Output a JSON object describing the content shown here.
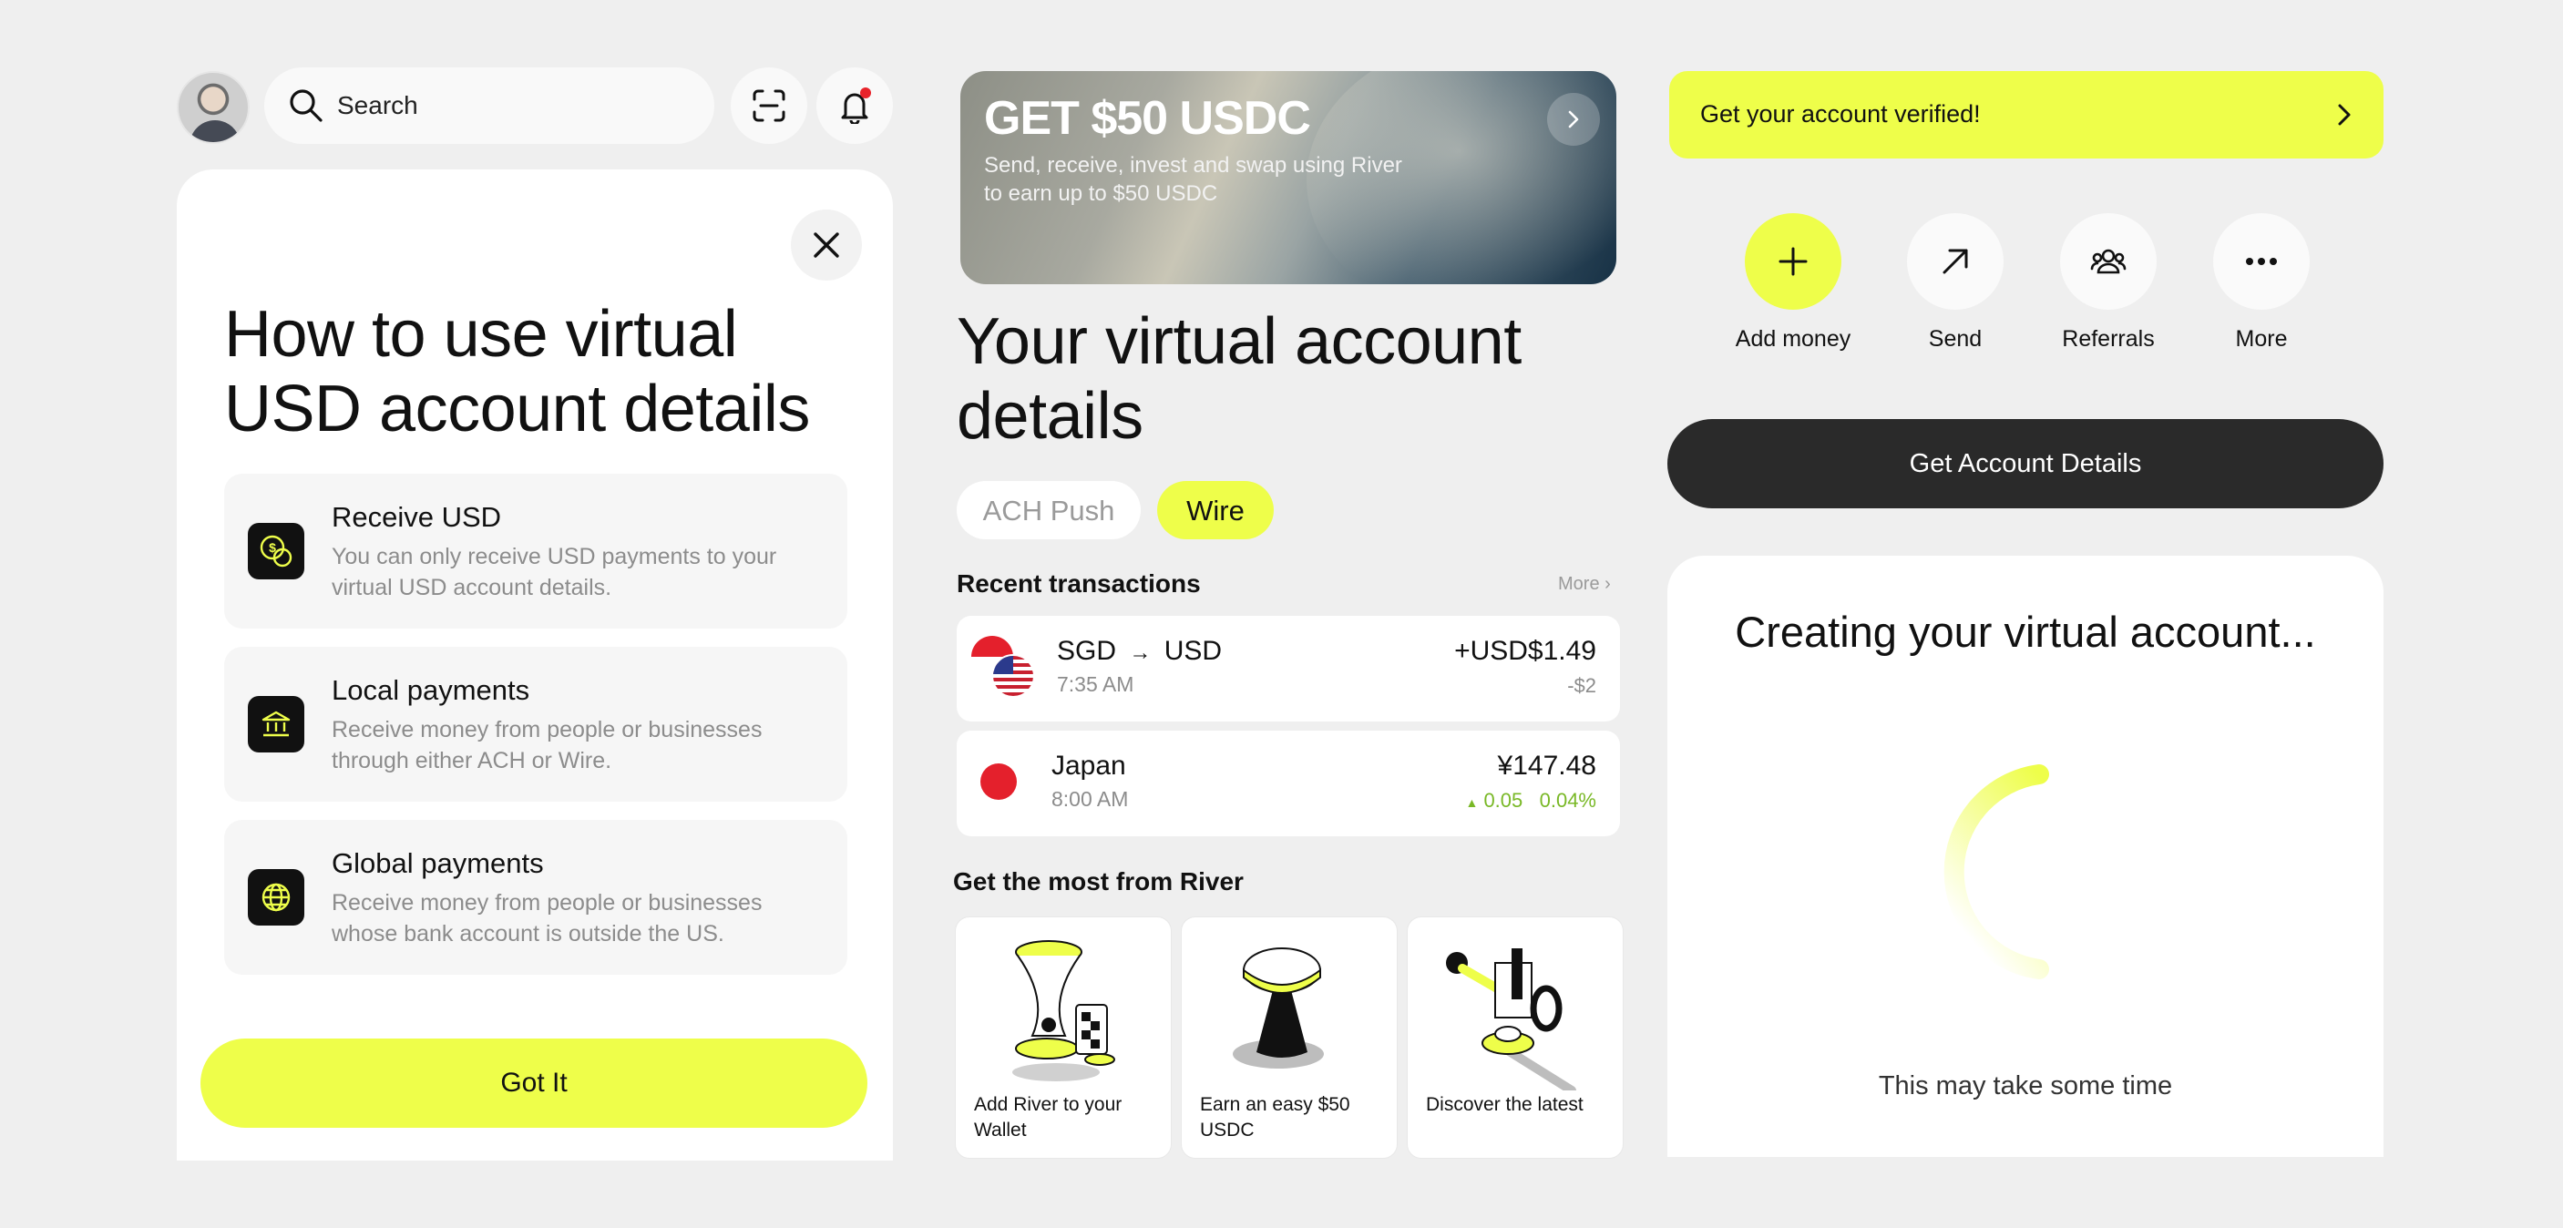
{
  "colors": {
    "accent": "#eefe4a",
    "background": "#efefef",
    "dark": "#2a2a2a",
    "positive": "#79b826"
  },
  "header": {
    "search_placeholder": "Search",
    "icons": [
      "search-icon",
      "scan-icon",
      "bell-icon"
    ]
  },
  "guide": {
    "title": "How to use virtual USD account details",
    "items": [
      {
        "icon": "dollar-coin-icon",
        "title": "Receive USD",
        "desc": "You can only receive USD payments to your virtual USD account details."
      },
      {
        "icon": "bank-icon",
        "title": "Local payments",
        "desc": "Receive money from people or businesses through either ACH or Wire."
      },
      {
        "icon": "globe-icon",
        "title": "Global payments",
        "desc": "Receive money from people or businesses whose bank account is outside the US."
      }
    ],
    "confirm_label": "Got It"
  },
  "promo": {
    "heading": "GET $50 USDC",
    "subtitle": "Send, receive, invest and swap using River to earn up to $50 USDC"
  },
  "account": {
    "title": "Your virtual account details",
    "tabs": [
      {
        "label": "ACH Push",
        "active": false
      },
      {
        "label": "Wire",
        "active": true
      }
    ]
  },
  "transactions": {
    "heading": "Recent transactions",
    "more_label": "More",
    "items": [
      {
        "from": "SGD",
        "to": "USD",
        "time": "7:35 AM",
        "amount": "+USD$1.49",
        "sub": "-$2"
      },
      {
        "name": "Japan",
        "time": "8:00 AM",
        "amount": "¥147.48",
        "change": "0.05",
        "change_pct": "0.04%"
      }
    ]
  },
  "discover": {
    "heading": "Get the most from River",
    "tiles": [
      {
        "label": "Add River to your Wallet"
      },
      {
        "label": "Earn an easy $50 USDC"
      },
      {
        "label": "Discover the latest"
      }
    ]
  },
  "verify": {
    "label": "Get your account verified!"
  },
  "actions": [
    {
      "label": "Add money",
      "icon": "plus-icon"
    },
    {
      "label": "Send",
      "icon": "arrow-up-right-icon"
    },
    {
      "label": "Referrals",
      "icon": "users-icon"
    },
    {
      "label": "More",
      "icon": "more-dots-icon"
    }
  ],
  "get_details_label": "Get Account Details",
  "creating": {
    "title": "Creating your virtual account...",
    "footnote": "This may take some time"
  }
}
